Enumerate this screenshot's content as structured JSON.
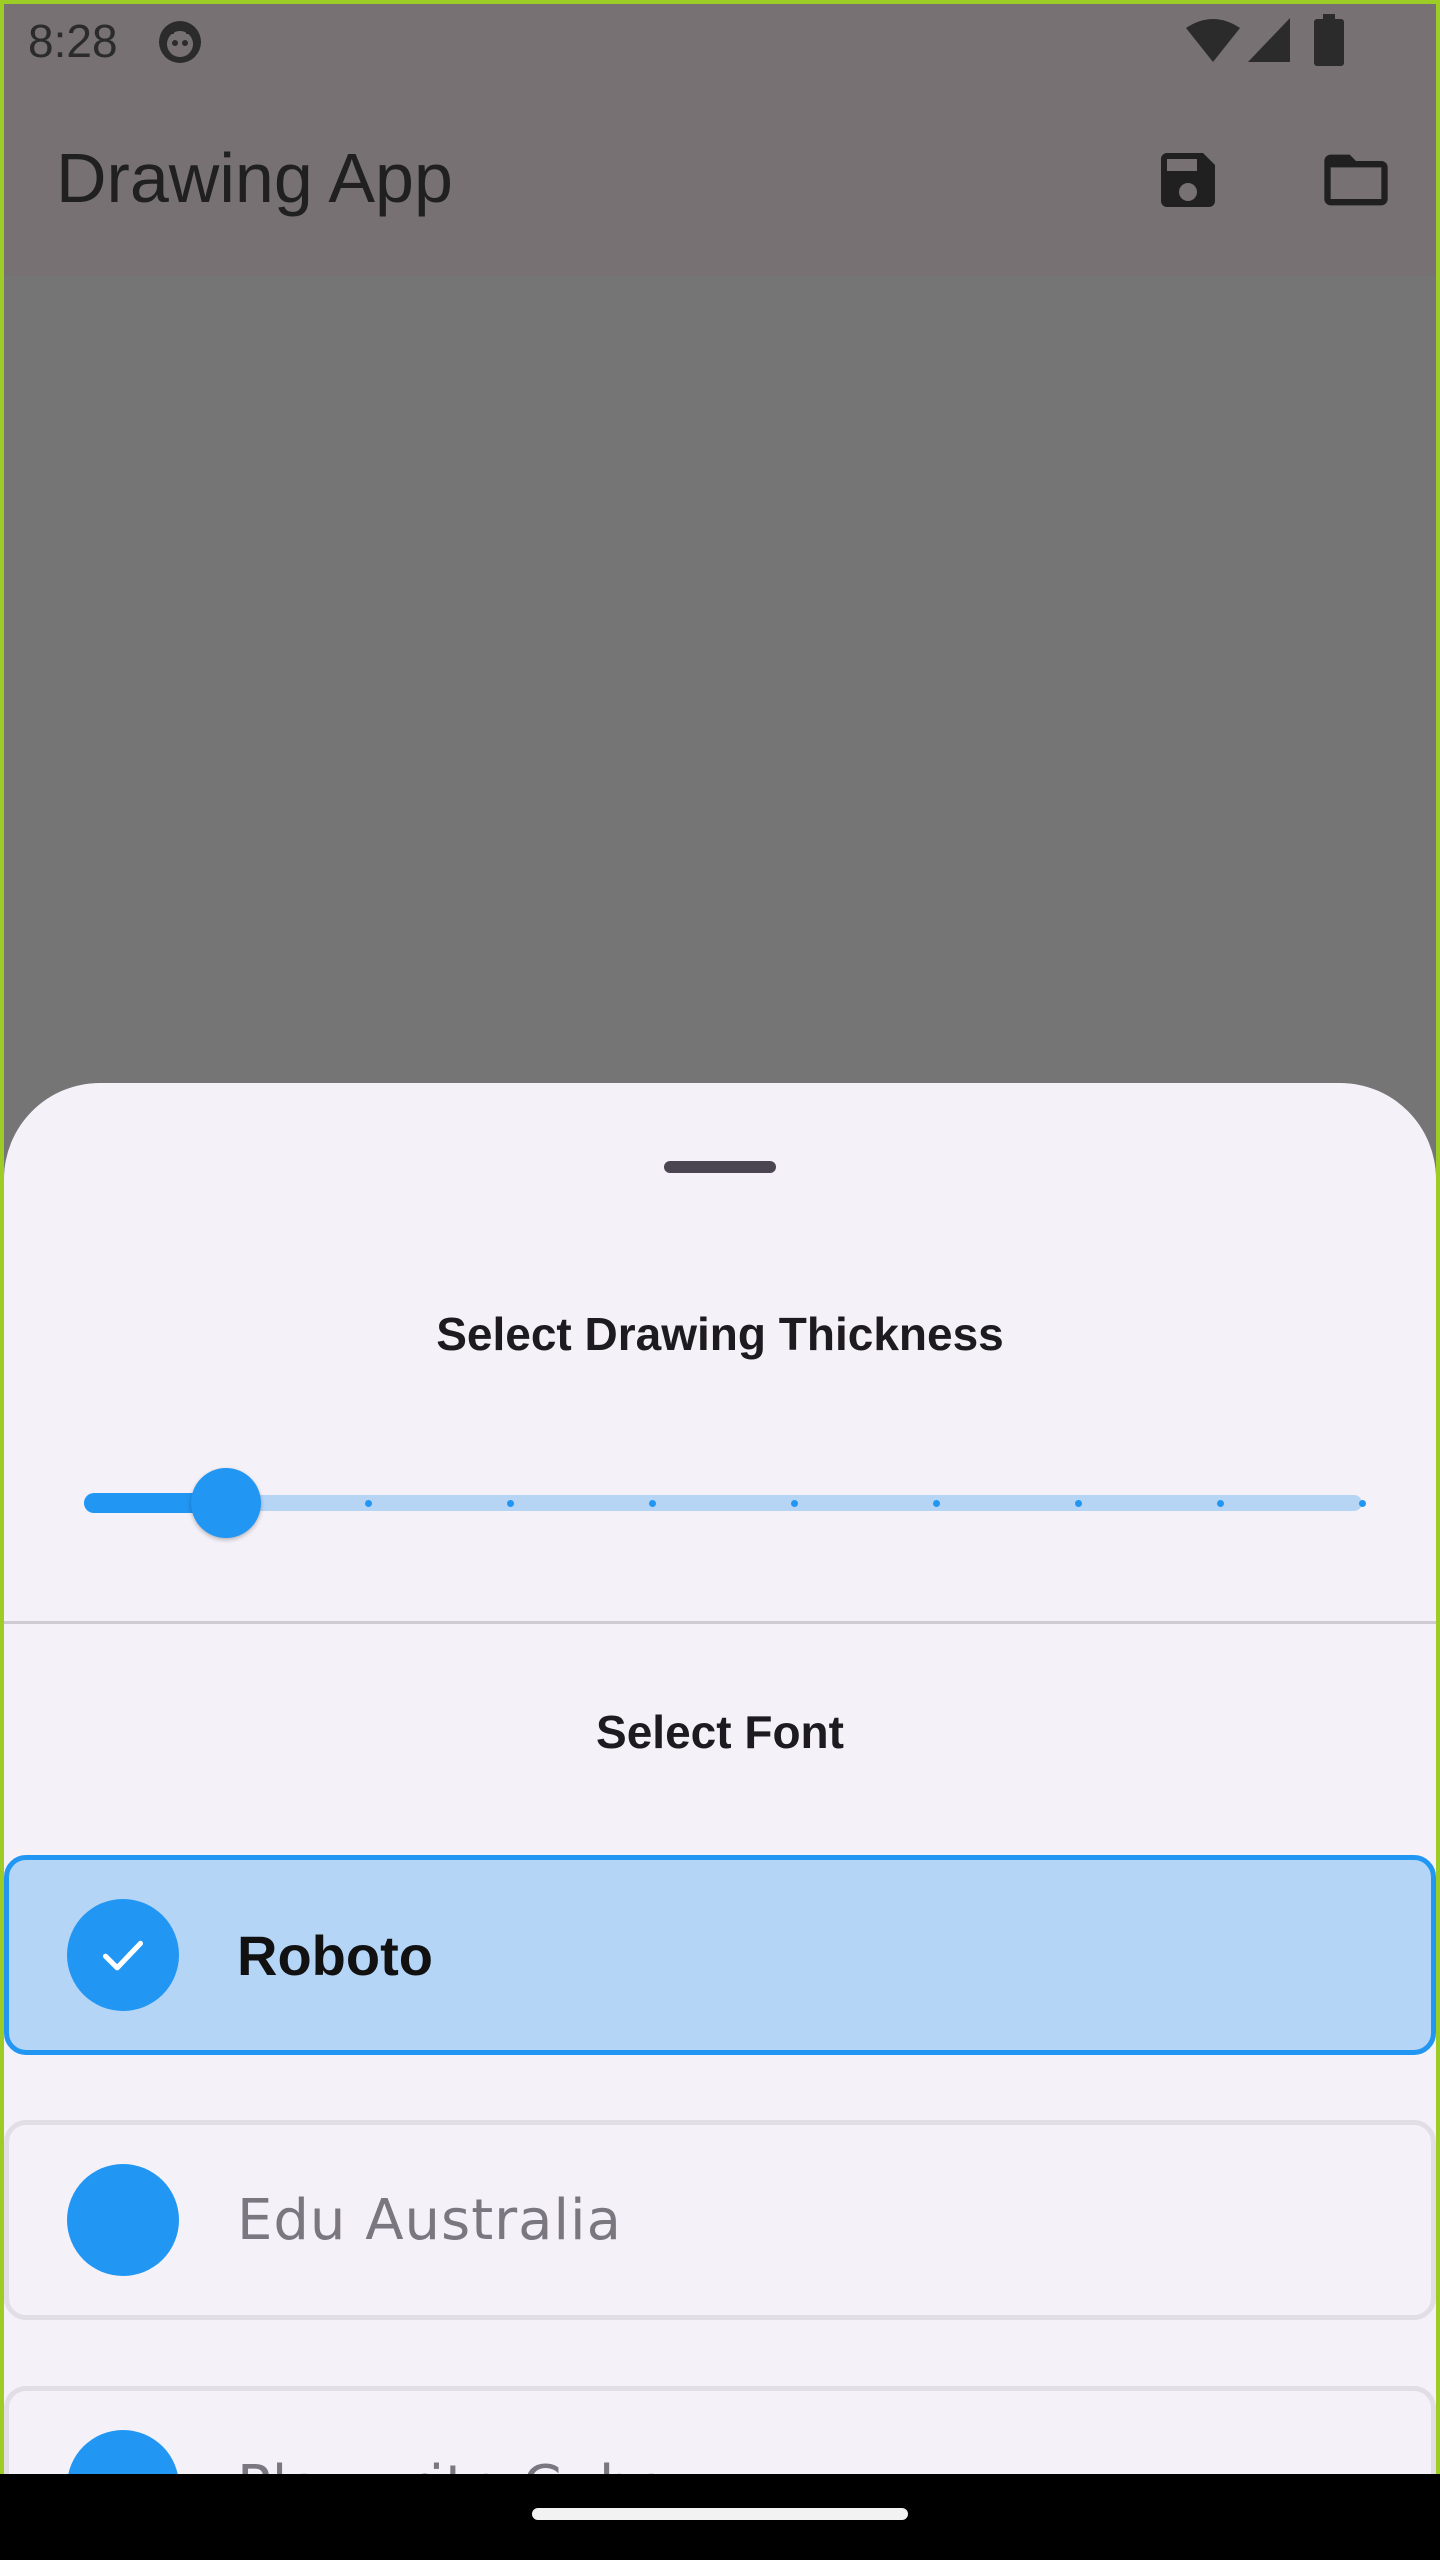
{
  "status_bar": {
    "time": "8:28",
    "icons": [
      "app-notification-icon",
      "wifi-icon",
      "signal-icon",
      "battery-icon"
    ]
  },
  "app_bar": {
    "title": "Drawing App",
    "actions": [
      {
        "name": "save",
        "icon": "save-icon"
      },
      {
        "name": "open",
        "icon": "folder-icon"
      }
    ]
  },
  "sheet": {
    "thickness_title": "Select Drawing Thickness",
    "slider": {
      "min": 1,
      "max": 10,
      "value": 2,
      "divisions": 9
    },
    "font_title": "Select Font",
    "fonts": [
      {
        "label": "Roboto",
        "selected": true
      },
      {
        "label": "Edu Australia",
        "selected": false
      },
      {
        "label": "Playwrite Cuba",
        "selected": false
      }
    ]
  },
  "colors": {
    "accent": "#2196f3",
    "selected_bg": "#b4d5f6",
    "sheet_bg": "#f5f1f8",
    "scrim": "#757575"
  }
}
